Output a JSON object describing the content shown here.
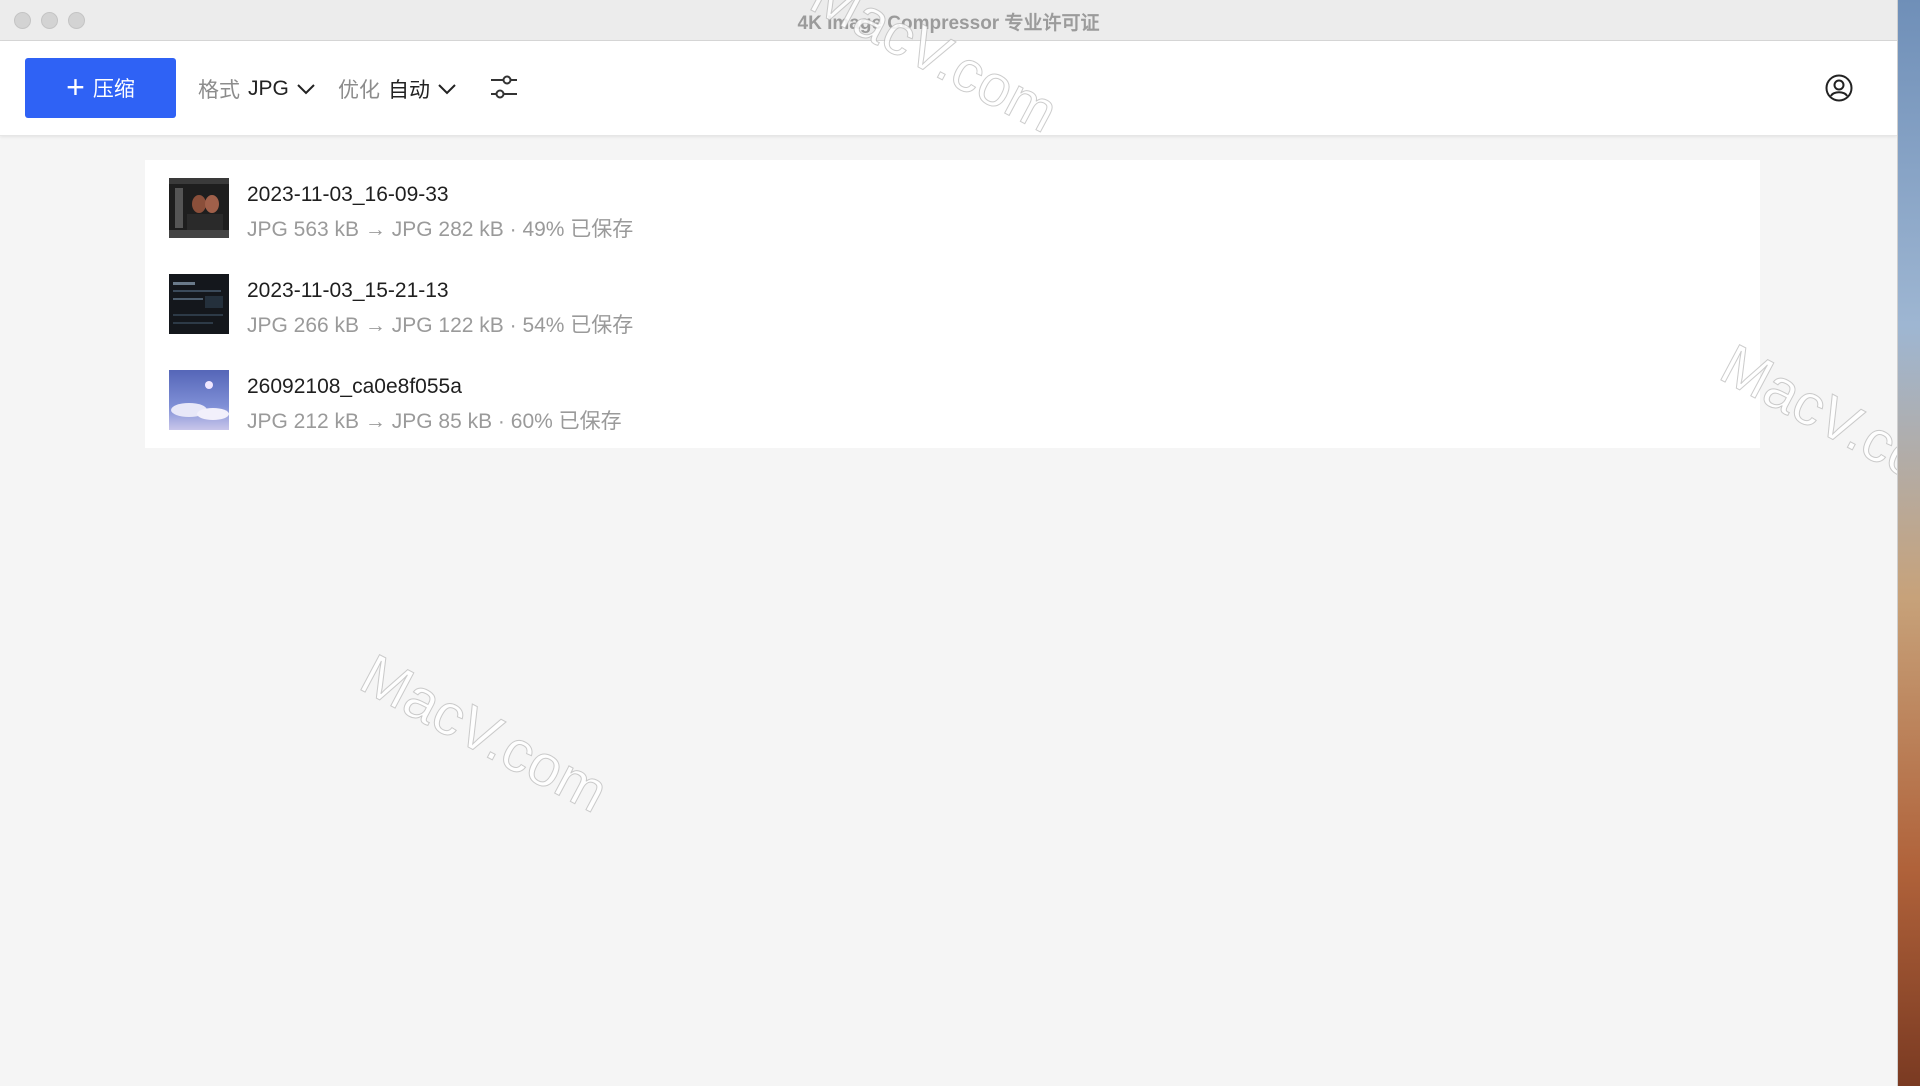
{
  "window": {
    "title": "4K Image Compressor 专业许可证"
  },
  "toolbar": {
    "compress_label": "压缩",
    "format": {
      "label": "格式",
      "value": "JPG"
    },
    "optimize": {
      "label": "优化",
      "value": "自动"
    }
  },
  "files": [
    {
      "name": "2023-11-03_16-09-33",
      "info": "JPG 563 kB → JPG 282 kB · 49% 已保存"
    },
    {
      "name": "2023-11-03_15-21-13",
      "info": "JPG 266 kB → JPG 122 kB · 54% 已保存"
    },
    {
      "name": "26092108_ca0e8f055a",
      "info": "JPG 212 kB → JPG 85 kB · 60% 已保存"
    }
  ],
  "watermarks": [
    "MacV.com",
    "MacV.com",
    "MacV.com"
  ],
  "colors": {
    "accent": "#2f62f5",
    "background": "#f5f5f5"
  }
}
